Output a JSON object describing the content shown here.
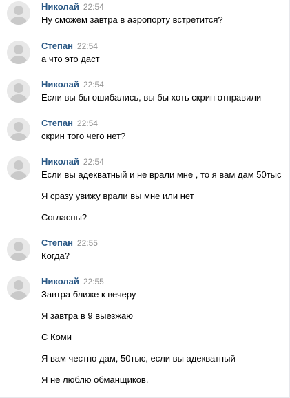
{
  "messages": [
    {
      "author": "Николай",
      "time": "22:54",
      "lines": [
        "Ну сможем завтра в аэропорту встретится?"
      ]
    },
    {
      "author": "Степан",
      "time": "22:54",
      "lines": [
        "а что это даст"
      ]
    },
    {
      "author": "Николай",
      "time": "22:54",
      "lines": [
        "Если вы бы ошибались, вы бы хоть скрин отправили"
      ]
    },
    {
      "author": "Степан",
      "time": "22:54",
      "lines": [
        "скрин того чего нет?"
      ]
    },
    {
      "author": "Николай",
      "time": "22:54",
      "lines": [
        "Если вы адекватный и не врали мне , то я вам дам 50тыс",
        "Я сразу увижу врали вы мне или нет",
        "Согласны?"
      ]
    },
    {
      "author": "Степан",
      "time": "22:55",
      "lines": [
        "Когда?"
      ]
    },
    {
      "author": "Николай",
      "time": "22:55",
      "lines": [
        "Завтра ближе к вечеру",
        "Я завтра в 9 выезжаю",
        "С Коми",
        "Я вам честно дам, 50тыс, если вы адекватный",
        "Я не люблю обманщиков."
      ]
    }
  ],
  "colors": {
    "author_name": "#2a5885",
    "timestamp": "#939393",
    "text": "#000000",
    "background": "#ffffff"
  },
  "icons": {
    "avatar": "user-avatar-icon"
  }
}
